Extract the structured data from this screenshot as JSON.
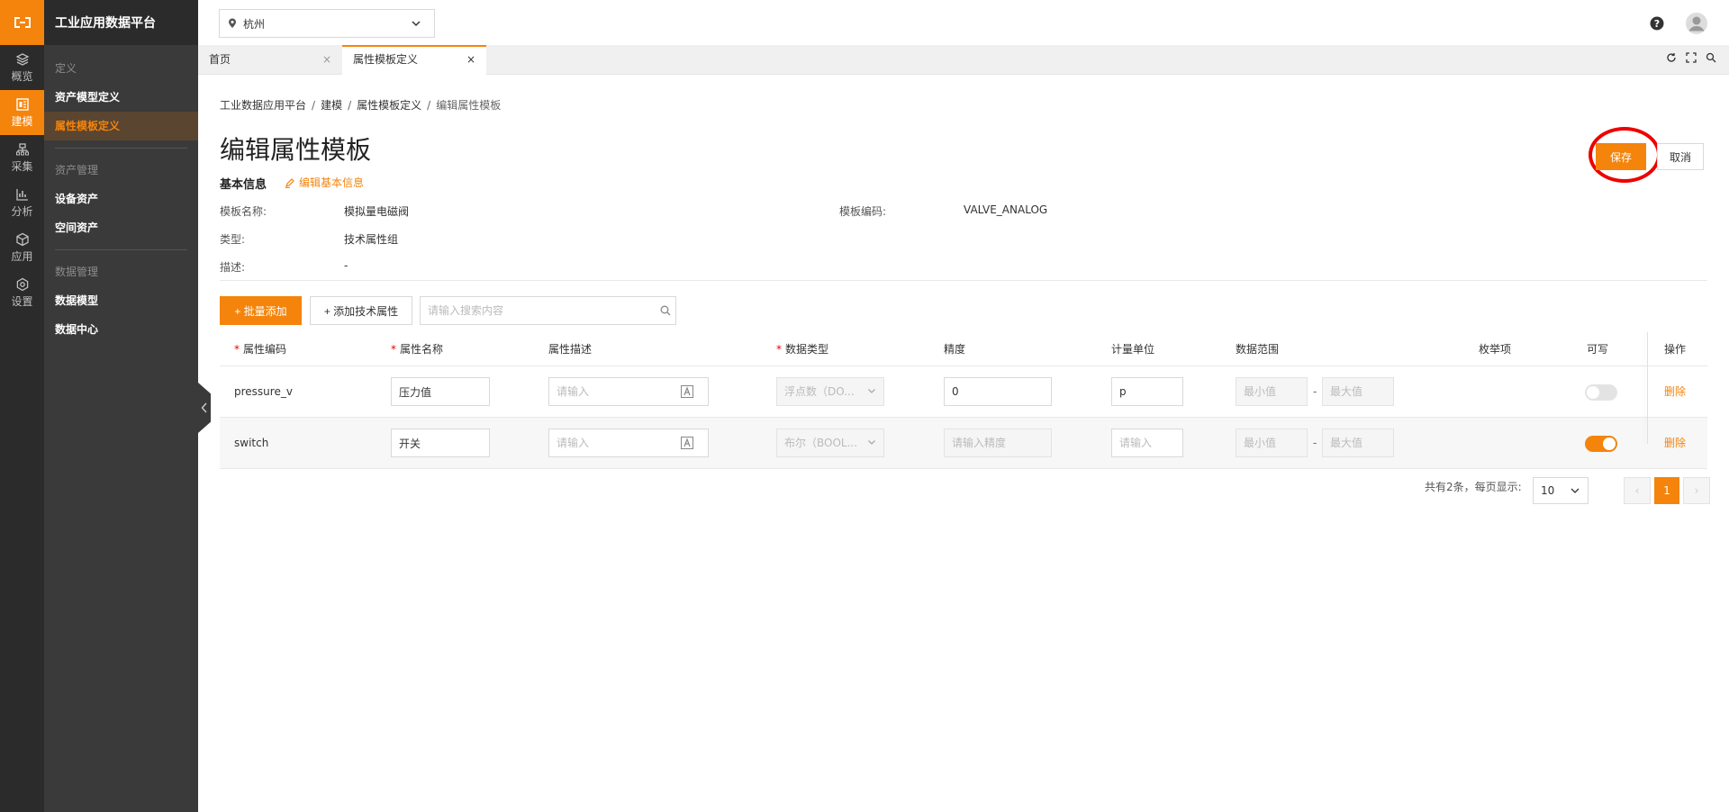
{
  "app": {
    "title": "工业应用数据平台"
  },
  "rail": [
    {
      "label": "概览",
      "icon": "layers-icon"
    },
    {
      "label": "建模",
      "icon": "modeling-icon"
    },
    {
      "label": "采集",
      "icon": "collect-icon"
    },
    {
      "label": "分析",
      "icon": "chart-icon"
    },
    {
      "label": "应用",
      "icon": "cube-icon"
    },
    {
      "label": "设置",
      "icon": "settings-icon"
    }
  ],
  "sidebar": {
    "sections": [
      {
        "title": "定义",
        "items": [
          "资产模型定义",
          "属性模板定义"
        ]
      },
      {
        "title": "资产管理",
        "items": [
          "设备资产",
          "空间资产"
        ]
      },
      {
        "title": "数据管理",
        "items": [
          "数据模型",
          "数据中心"
        ]
      }
    ],
    "active_item": "属性模板定义"
  },
  "topbar": {
    "location": "杭州"
  },
  "tabs": [
    {
      "label": "首页",
      "close": "×"
    },
    {
      "label": "属性模板定义",
      "close": "×"
    }
  ],
  "breadcrumb": [
    "工业数据应用平台",
    "建模",
    "属性模板定义",
    "编辑属性模板"
  ],
  "breadcrumb_sep": "/",
  "page": {
    "title": "编辑属性模板",
    "save": "保存",
    "cancel": "取消",
    "basic_info": "基本信息",
    "edit_basic": "编辑基本信息"
  },
  "info": {
    "name_label": "模板名称:",
    "name_value": "模拟量电磁阀",
    "code_label": "模板编码:",
    "code_value": "VALVE_ANALOG",
    "type_label": "类型:",
    "type_value": "技术属性组",
    "desc_label": "描述:",
    "desc_value": "-"
  },
  "toolbar": {
    "batch_add": "+ 批量添加",
    "add_tech": "+ 添加技术属性",
    "search_placeholder": "请输入搜索内容"
  },
  "table": {
    "required_mark": "*",
    "headers": [
      "属性编码",
      "属性名称",
      "属性描述",
      "数据类型",
      "精度",
      "计量单位",
      "数据范围",
      "枚举项",
      "可写",
      "操作"
    ],
    "rows": [
      {
        "code": "pressure_v",
        "name": "压力值",
        "desc_placeholder": "请输入",
        "data_type": "浮点数（DO...",
        "precision": "0",
        "precision_placeholder": "",
        "unit": "p",
        "unit_placeholder": "",
        "min_placeholder": "最小值",
        "max_placeholder": "最大值",
        "range_sep": "-",
        "writable": false,
        "delete": "删除"
      },
      {
        "code": "switch",
        "name": "开关",
        "desc_placeholder": "请输入",
        "data_type": "布尔（BOOL...",
        "precision": "",
        "precision_placeholder": "请输入精度",
        "unit": "",
        "unit_placeholder": "请输入",
        "min_placeholder": "最小值",
        "max_placeholder": "最大值",
        "range_sep": "-",
        "writable": true,
        "delete": "删除"
      }
    ]
  },
  "pagination": {
    "total_text": "共有2条，每页显示:",
    "page_size": "10",
    "prev": "‹",
    "current": "1",
    "next": "›"
  },
  "colors": {
    "accent": "#f4840c",
    "rail_bg": "#2b2b2b",
    "sidebar_bg": "#3a3a3a",
    "highlight_ring": "#e00000"
  }
}
